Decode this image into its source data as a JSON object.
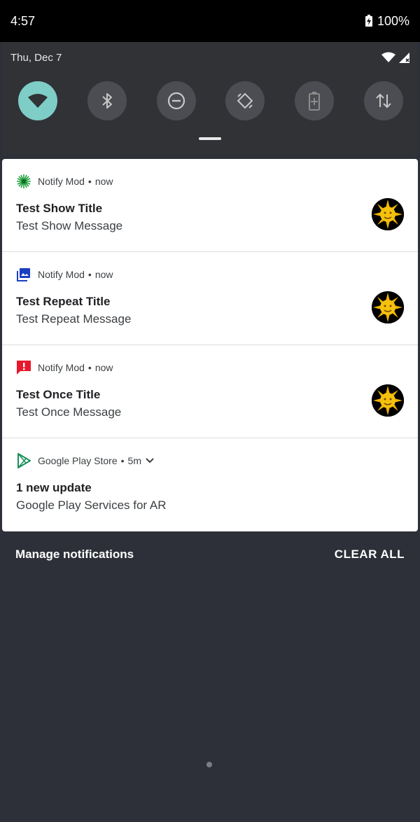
{
  "status_bar": {
    "time": "4:57",
    "battery": "100%"
  },
  "quick_settings": {
    "date": "Thu, Dec 7",
    "tiles": [
      {
        "name": "wifi",
        "active": true
      },
      {
        "name": "bluetooth",
        "active": false
      },
      {
        "name": "do-not-disturb",
        "active": false
      },
      {
        "name": "auto-rotate",
        "active": false
      },
      {
        "name": "battery-saver",
        "active": false
      },
      {
        "name": "mobile-data",
        "active": false
      }
    ]
  },
  "notifications": [
    {
      "app": "Notify Mod",
      "time": "now",
      "title": "Test Show Title",
      "text": "Test Show Message",
      "icon": "green-starburst-icon"
    },
    {
      "app": "Notify Mod",
      "time": "now",
      "title": "Test Repeat Title",
      "text": "Test Repeat Message",
      "icon": "image-icon"
    },
    {
      "app": "Notify Mod",
      "time": "now",
      "title": "Test Once Title",
      "text": "Test Once Message",
      "icon": "alert-icon"
    },
    {
      "app": "Google Play Store",
      "time": "5m",
      "title": "1 new update",
      "text": "Google Play Services for AR",
      "icon": "play-store-icon"
    }
  ],
  "sep": "•",
  "footer": {
    "manage": "Manage notifications",
    "clear": "CLEAR ALL"
  },
  "colors": {
    "accent": "#7ecdc7",
    "background": "#2d3038",
    "card": "#ffffff"
  }
}
